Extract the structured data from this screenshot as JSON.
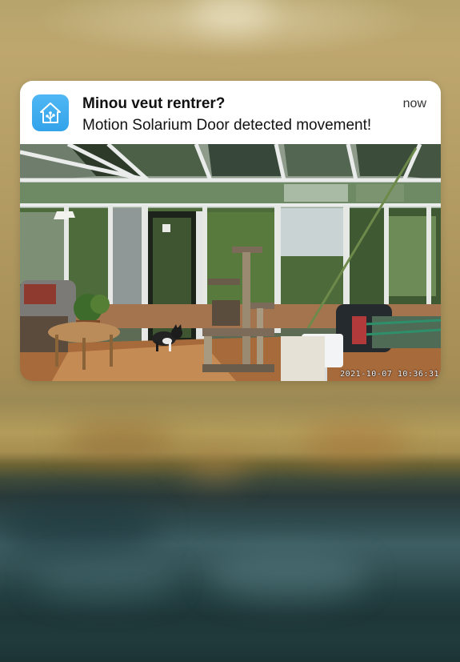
{
  "notification": {
    "app_icon": "home-assistant-icon",
    "title": "Minou veut rentrer?",
    "time": "now",
    "message": "Motion Solarium Door detected movement!",
    "image": {
      "kind": "camera-snapshot",
      "timestamp": "2021-10-07  10:36:31"
    }
  },
  "colors": {
    "icon_blue": "#41BDF5",
    "card_background": "#FFFFFF",
    "text": "#111111"
  }
}
